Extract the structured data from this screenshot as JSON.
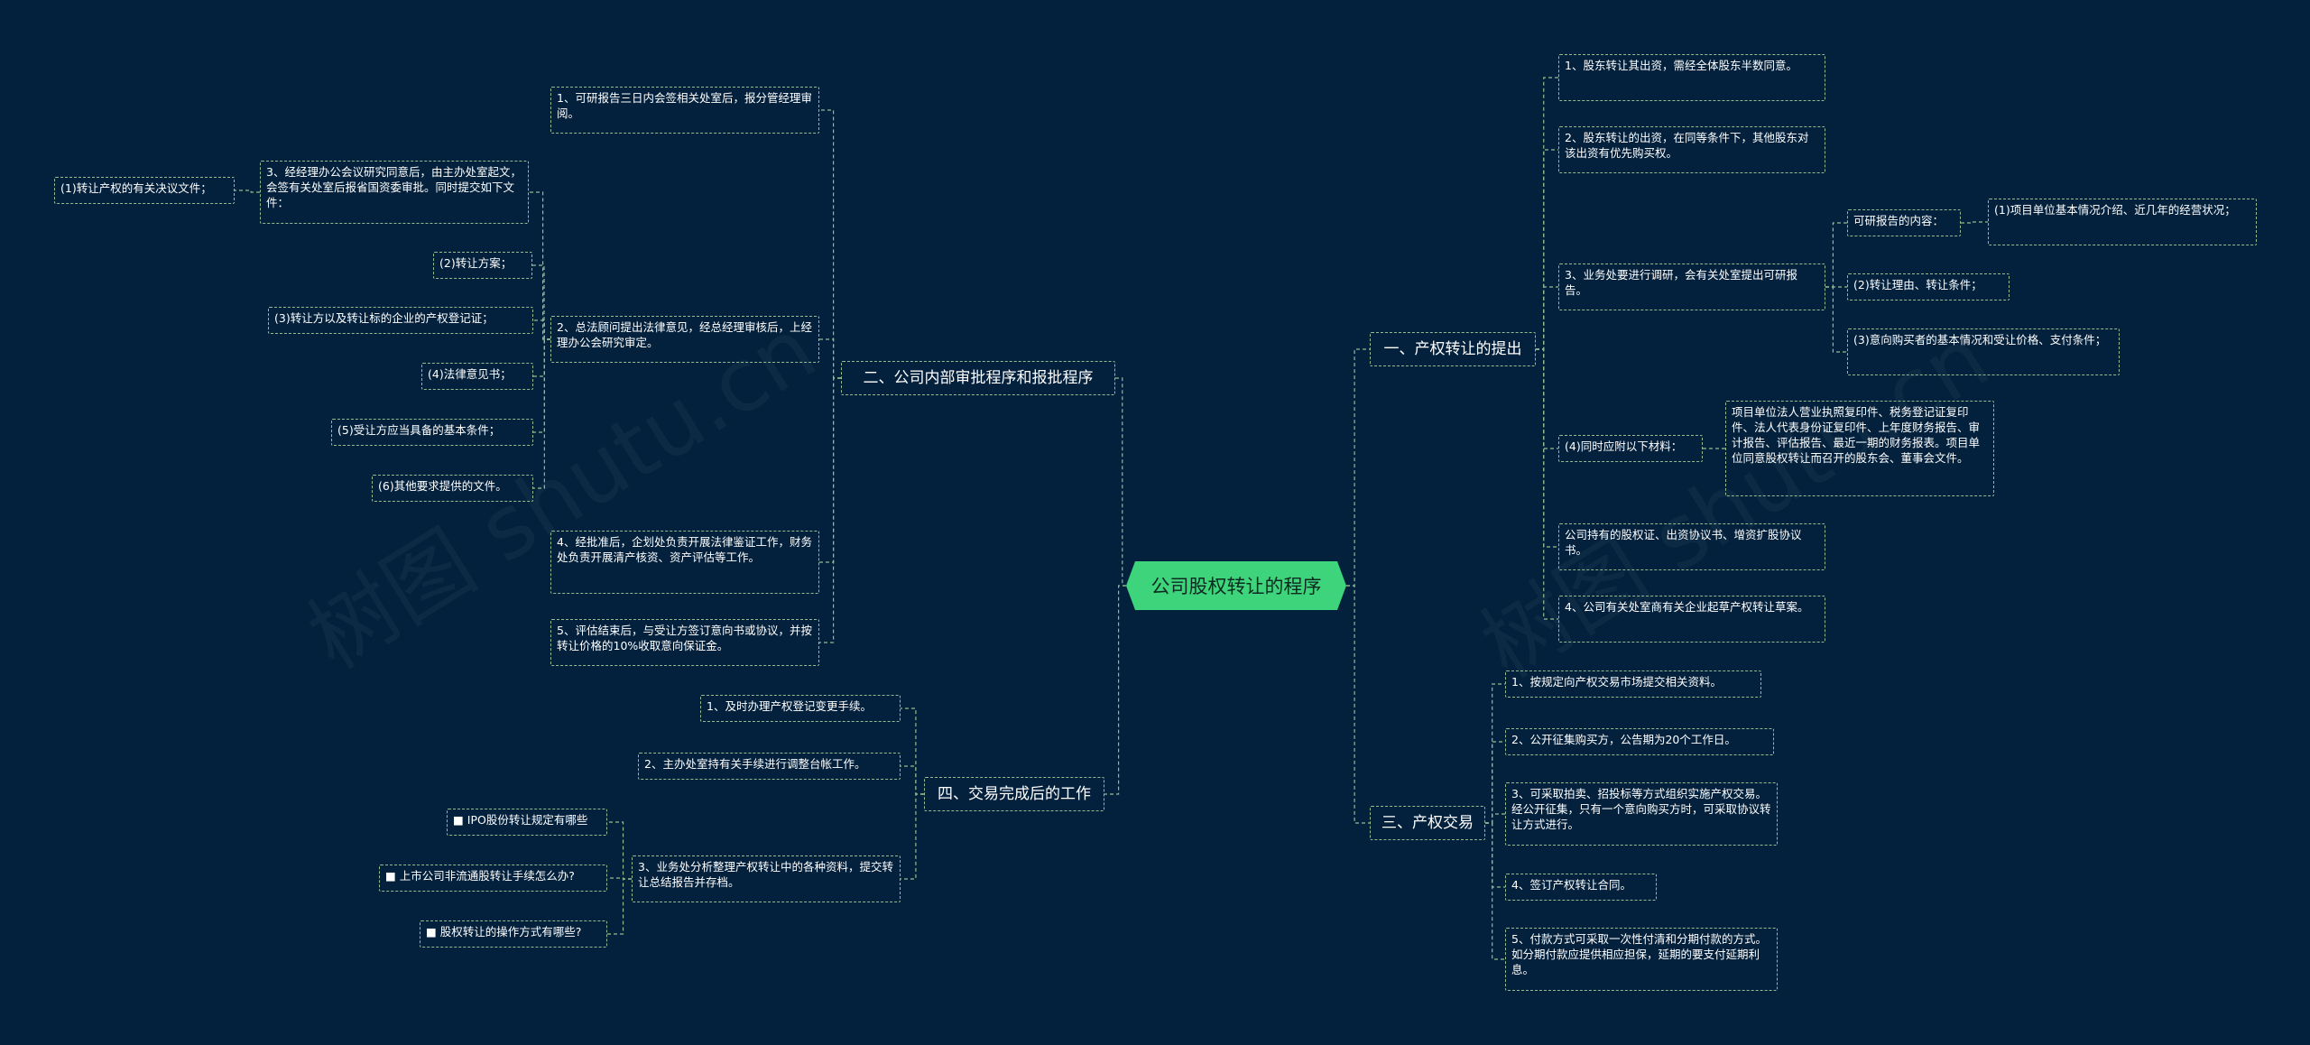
{
  "root": "公司股权转让的程序",
  "branches": {
    "b1": "一、产权转让的提出",
    "b2": "二、公司内部审批程序和报批程序",
    "b3": "三、产权交易",
    "b4": "四、交易完成后的工作"
  },
  "b1": {
    "n1": "1、股东转让其出资，需经全体股东半数同意。",
    "n2": "2、股东转让的出资，在同等条件下，其他股东对该出资有优先购买权。",
    "n3": "3、业务处要进行调研，会有关处室提出可研报告。",
    "n3a": "可研报告的内容：",
    "n3a1": "(1)项目单位基本情况介绍、近几年的经营状况；",
    "n3b": "(2)转让理由、转让条件；",
    "n3c": "(3)意向购买者的基本情况和受让价格、支付条件；",
    "n4": "(4)同时应附以下材料：",
    "n4a": "项目单位法人营业执照复印件、税务登记证复印件、法人代表身份证复印件、上年度财务报告、审计报告、评估报告、最近一期的财务报表。项目单位同意股权转让而召开的股东会、董事会文件。",
    "n5": "公司持有的股权证、出资协议书、增资扩股协议书。",
    "n6": "4、公司有关处室商有关企业起草产权转让草案。"
  },
  "b2": {
    "n1": "1、可研报告三日内会签相关处室后，报分管经理审阅。",
    "n2": "2、总法顾问提出法律意见，经总经理审核后，上经理办公会研究审定。",
    "n3": "3、经经理办公会议研究同意后，由主办处室起文，会签有关处室后报省国资委审批。同时提交如下文件：",
    "n3a": "(1)转让产权的有关决议文件；",
    "n2a": "(2)转让方案；",
    "n2b": "(3)转让方以及转让标的企业的产权登记证；",
    "n2c": "(4)法律意见书；",
    "n2d": "(5)受让方应当具备的基本条件；",
    "n2e": "(6)其他要求提供的文件。",
    "n4": "4、经批准后，企划处负责开展法律鉴证工作，财务处负责开展清产核资、资产评估等工作。",
    "n5": "5、评估结束后，与受让方签订意向书或协议，并按转让价格的10%收取意向保证金。"
  },
  "b3": {
    "n1": "1、按规定向产权交易市场提交相关资料。",
    "n2": "2、公开征集购买方，公告期为20个工作日。",
    "n3": "3、可采取拍卖、招投标等方式组织实施产权交易。经公开征集，只有一个意向购买方时，可采取协议转让方式进行。",
    "n4": "4、签订产权转让合同。",
    "n5": "5、付款方式可采取一次性付清和分期付款的方式。如分期付款应提供相应担保，延期的要支付延期利息。"
  },
  "b4": {
    "n1": "1、及时办理产权登记变更手续。",
    "n2": "2、主办处室持有关手续进行调整台帐工作。",
    "n3": "3、业务处分析整理产权转让中的各种资料，提交转让总结报告并存档。",
    "n3a": "■ IPO股份转让规定有哪些",
    "n3b": "■ 上市公司非流通股转让手续怎么办?",
    "n3c": "■ 股权转让的操作方式有哪些?"
  },
  "watermarks": [
    "树图 shutu.cn",
    "树图 shutu.cn"
  ],
  "colors": {
    "background": "#03213c",
    "root": "#3ed47b",
    "line": "#8fbf8f",
    "text": "#ffffff"
  }
}
